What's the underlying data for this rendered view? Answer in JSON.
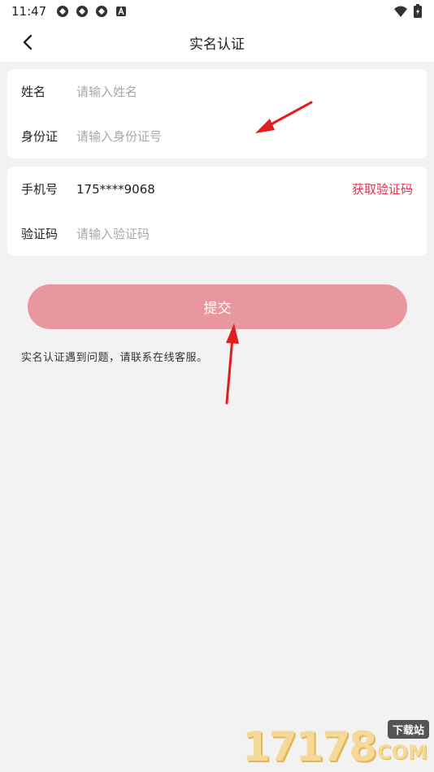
{
  "status_bar": {
    "time": "11:47",
    "notification_icons": [
      "app-icon",
      "app-icon",
      "app-icon",
      "a-icon"
    ],
    "right_icons": [
      "wifi-icon",
      "battery-charging-icon"
    ]
  },
  "header": {
    "title": "实名认证",
    "back_icon": "chevron-left-icon"
  },
  "identity_card": {
    "name_label": "姓名",
    "name_placeholder": "请输入姓名",
    "id_label": "身份证",
    "id_placeholder": "请输入身份证号"
  },
  "phone_card": {
    "phone_label": "手机号",
    "phone_value": "175****9068",
    "get_code_label": "获取验证码",
    "code_label": "验证码",
    "code_placeholder": "请输入验证码"
  },
  "submit_label": "提交",
  "hint_text": "实名认证遇到问题，请联系在线客服。",
  "watermark": {
    "number": "17178",
    "tag": "下载站",
    "domain": "COM"
  },
  "colors": {
    "accent_red": "#e0334d",
    "submit_bg": "#e9979e",
    "page_bg": "#f2f2f2",
    "arrow_red": "#e11d1d"
  }
}
